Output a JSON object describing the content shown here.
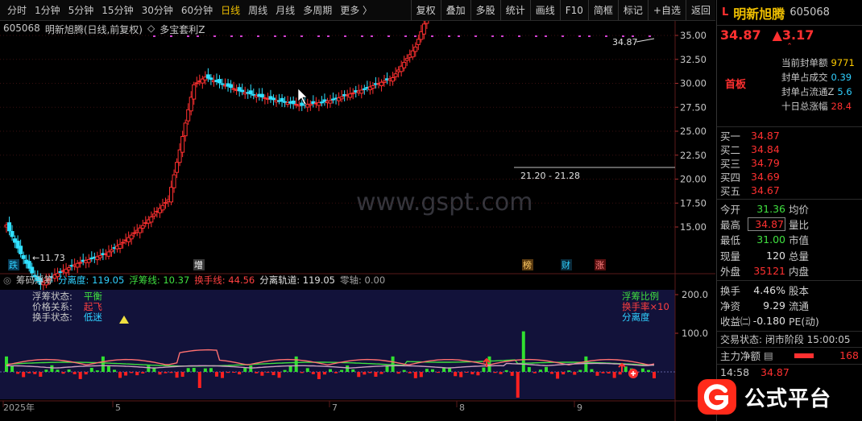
{
  "toolbar": {
    "periods": [
      "分时",
      "1分钟",
      "5分钟",
      "15分钟",
      "30分钟",
      "60分钟",
      "日线",
      "周线",
      "月线",
      "多周期",
      "更多 〉"
    ],
    "active_period": "日线",
    "tools": [
      "复权",
      "叠加",
      "多股",
      "统计",
      "画线",
      "F10",
      "简框",
      "标记",
      "+自选",
      "返回"
    ]
  },
  "chart_header": {
    "code": "605068",
    "name": "明新旭腾(日线,前复权)",
    "formula_arrow": "◇",
    "formula": "多宝套利Z"
  },
  "watermark": "www.gspt.com",
  "main_axis": {
    "ticks": [
      "35.00",
      "32.50",
      "30.00",
      "27.50",
      "25.00",
      "22.50",
      "20.00",
      "17.50",
      "15.00"
    ]
  },
  "annotations": {
    "high": "34.87",
    "low": "11.73",
    "range": "21.20 - 21.28"
  },
  "event_tags": [
    {
      "label": "跌",
      "color": "#30d0ff",
      "bg": "#0a3a55"
    },
    {
      "label": "增",
      "color": "#ffffff",
      "bg": "#3a3a3a"
    },
    {
      "label": "榜",
      "color": "#ffcc66",
      "bg": "#5a3a10"
    },
    {
      "label": "财",
      "color": "#30d0ff",
      "bg": "#0a2a3a"
    },
    {
      "label": "涨",
      "color": "#ff8080",
      "bg": "#5a1010"
    }
  ],
  "indicator_header": {
    "name": "筹码浮筹",
    "items": [
      {
        "label": "分离度: 119.05",
        "color": "#30d0ff"
      },
      {
        "label": "浮筹线: 10.37",
        "color": "#40e040"
      },
      {
        "label": "换手线: 44.56",
        "color": "#ff4040"
      },
      {
        "label": "分离轨道: 119.05",
        "color": "#e0e0e0"
      },
      {
        "label": "零轴: 0.00",
        "color": "#a0a0a0"
      }
    ]
  },
  "status_labels": [
    {
      "key": "浮筹状态:",
      "value": "平衡",
      "value_color": "#40e040"
    },
    {
      "key": "价格关系:",
      "value": "起飞",
      "value_color": "#ff4040"
    },
    {
      "key": "换手状态:",
      "value": "低迷",
      "value_color": "#30d0ff"
    }
  ],
  "indicator_legend": [
    {
      "label": "浮筹比例",
      "color": "#40e040"
    },
    {
      "label": "换手率×10",
      "color": "#ff4040"
    },
    {
      "label": "分离度",
      "color": "#30d0ff"
    }
  ],
  "indicator_axis": {
    "ticks": [
      "200.0",
      "100.0"
    ]
  },
  "date_axis": {
    "labels": [
      "2025年",
      "5",
      "7",
      "8",
      "9"
    ]
  },
  "panel": {
    "flag": "L",
    "name": "明新旭腾",
    "code": "605068",
    "price": "34.87",
    "change": "▲3.17",
    "limit_tag": "首板",
    "limit_rows": [
      {
        "k": "当前封单额",
        "v": "9771",
        "color": "#ffcc00"
      },
      {
        "k": "封单占成交",
        "v": "0.39",
        "color": "#30d0ff"
      },
      {
        "k": "封单占流通Z",
        "v": "5.6",
        "color": "#30d0ff"
      },
      {
        "k": "十日总涨幅",
        "v": "28.4",
        "color": "#ff3030"
      }
    ],
    "book": [
      {
        "label": "买一",
        "price": "34.87"
      },
      {
        "label": "买二",
        "price": "34.84"
      },
      {
        "label": "买三",
        "price": "34.79"
      },
      {
        "label": "买四",
        "price": "34.69"
      },
      {
        "label": "买五",
        "price": "34.67"
      }
    ],
    "stats": [
      {
        "k": "今开",
        "v": "31.36",
        "vc": "#40e040",
        "k2": "均价"
      },
      {
        "k": "最高",
        "v": "34.87",
        "vc": "#ff3030",
        "k2": "量比"
      },
      {
        "k": "最低",
        "v": "31.00",
        "vc": "#40e040",
        "k2": "市值"
      },
      {
        "k": "现量",
        "v": "120",
        "vc": "#e0e0e0",
        "k2": "总量"
      },
      {
        "k": "外盘",
        "v": "35121",
        "vc": "#ff3030",
        "k2": "内盘"
      }
    ],
    "stats2": [
      {
        "k": "换手",
        "v": "4.46%",
        "vc": "#e0e0e0",
        "k2": "股本"
      },
      {
        "k": "净资",
        "v": "9.29",
        "vc": "#e0e0e0",
        "k2": "流通"
      },
      {
        "k": "收益㈡",
        "v": "-0.180",
        "vc": "#e0e0e0",
        "k2": "PE(动)"
      }
    ],
    "trade_status": "交易状态: 闭市阶段 15:00:05",
    "net_label": "主力净额",
    "net_value": "168",
    "tick_time": "14:58",
    "tick_price": "34.87"
  },
  "logo": {
    "text": "公式平台"
  },
  "colors": {
    "up": "#ff3030",
    "down": "#30e0ff",
    "accent": "#f0c000",
    "grid": "#3a1010"
  }
}
